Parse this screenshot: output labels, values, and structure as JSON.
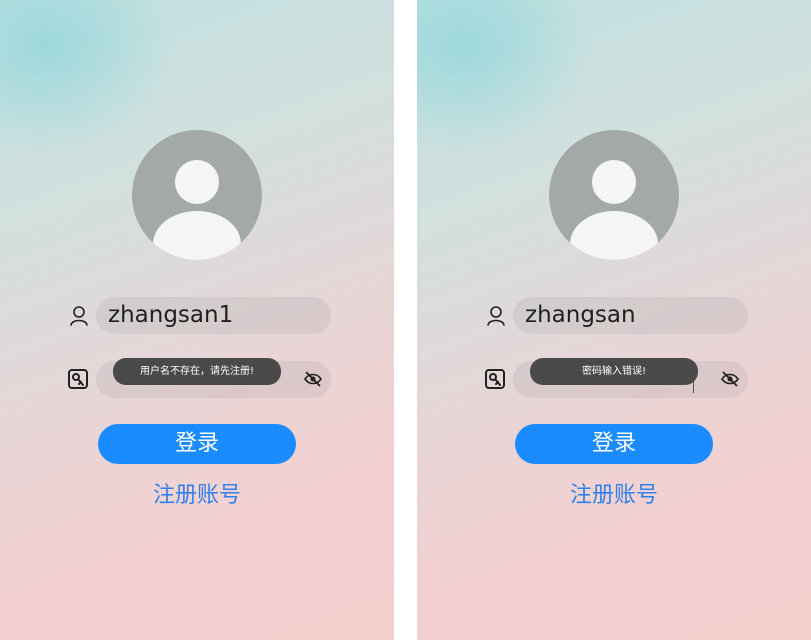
{
  "screens": [
    {
      "username_value": "zhangsan1",
      "toast_text": "用户名不存在，请先注册!",
      "login_label": "登录",
      "register_label": "注册账号"
    },
    {
      "username_value": "zhangsan",
      "toast_text": "密码输入错误!",
      "login_label": "登录",
      "register_label": "注册账号"
    }
  ],
  "colors": {
    "accent": "#1a8cff",
    "link": "#2f82ec",
    "toast_bg": "#4a4a4a",
    "avatar_bg": "#a3a9a7"
  },
  "icons": [
    "user-icon",
    "key-icon",
    "eye-off-icon",
    "avatar-placeholder-icon"
  ]
}
